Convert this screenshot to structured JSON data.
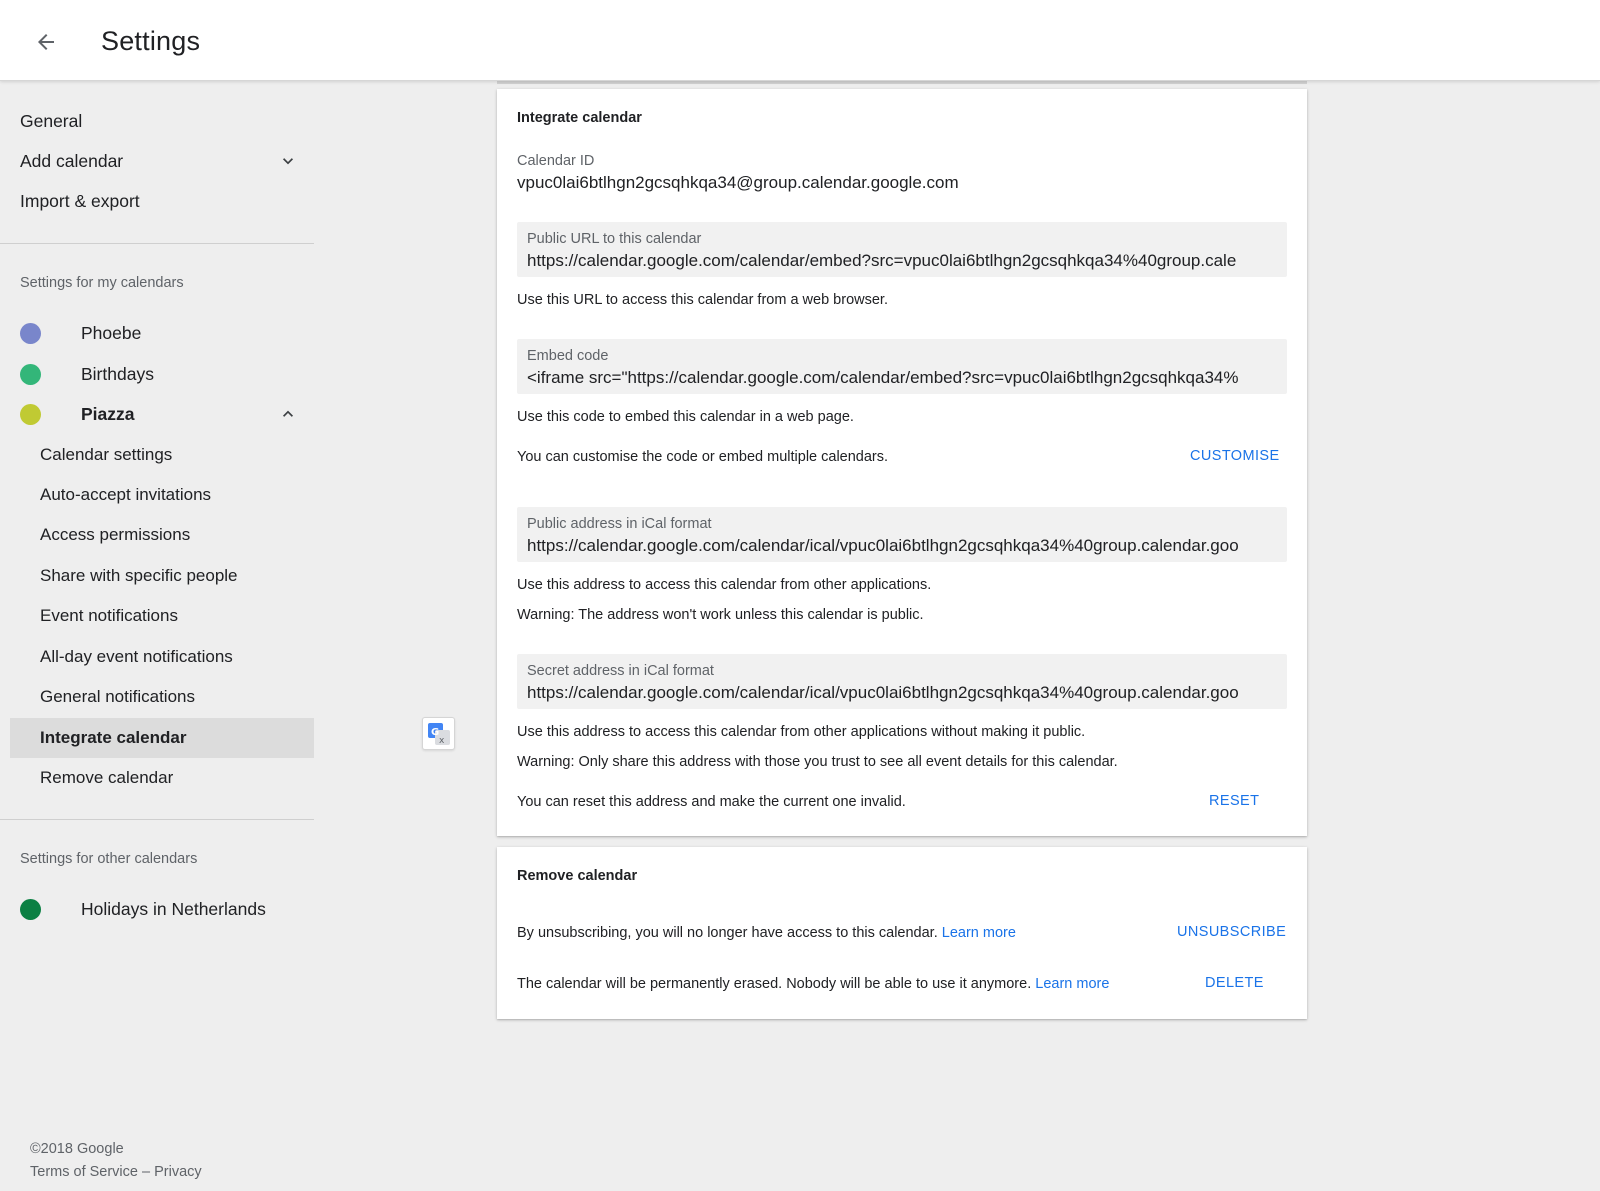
{
  "header": {
    "title": "Settings"
  },
  "sidebar": {
    "top_items": [
      {
        "label": "General"
      },
      {
        "label": "Add calendar"
      },
      {
        "label": "Import & export"
      }
    ],
    "my_calendars_label": "Settings for my calendars",
    "my_calendars": [
      {
        "name": "Phoebe",
        "color": "#7986cb"
      },
      {
        "name": "Birthdays",
        "color": "#33b679"
      },
      {
        "name": "Piazza",
        "color": "#c0ca33"
      }
    ],
    "piazza_subitems": [
      {
        "label": "Calendar settings"
      },
      {
        "label": "Auto-accept invitations"
      },
      {
        "label": "Access permissions"
      },
      {
        "label": "Share with specific people"
      },
      {
        "label": "Event notifications"
      },
      {
        "label": "All-day event notifications"
      },
      {
        "label": "General notifications"
      },
      {
        "label": "Integrate calendar"
      },
      {
        "label": "Remove calendar"
      }
    ],
    "active_subitem": "Integrate calendar",
    "other_calendars_label": "Settings for other calendars",
    "other_calendars": [
      {
        "name": "Holidays in Netherlands",
        "color": "#0b8043"
      }
    ]
  },
  "footer": {
    "copyright": "©2018 Google",
    "terms": "Terms of Service",
    "separator": "–",
    "privacy": "Privacy"
  },
  "integrate": {
    "title": "Integrate calendar",
    "calendar_id_label": "Calendar ID",
    "calendar_id_value": "vpuc0lai6btlhgn2gcsqhkqa34@group.calendar.google.com",
    "public_url_label": "Public URL to this calendar",
    "public_url_value": "https://calendar.google.com/calendar/embed?src=vpuc0lai6btlhgn2gcsqhkqa34%40group.cale",
    "public_url_desc": "Use this URL to access this calendar from a web browser.",
    "embed_label": "Embed code",
    "embed_value": "<iframe src=\"https://calendar.google.com/calendar/embed?src=vpuc0lai6btlhgn2gcsqhkqa34%",
    "embed_desc": "Use this code to embed this calendar in a web page.",
    "customise_desc": "You can customise the code or embed multiple calendars.",
    "customise_button": "CUSTOMISE",
    "ical_public_label": "Public address in iCal format",
    "ical_public_value": "https://calendar.google.com/calendar/ical/vpuc0lai6btlhgn2gcsqhkqa34%40group.calendar.goo",
    "ical_public_desc": "Use this address to access this calendar from other applications.",
    "ical_public_warning": "Warning: The address won't work unless this calendar is public.",
    "ical_secret_label": "Secret address in iCal format",
    "ical_secret_value": "https://calendar.google.com/calendar/ical/vpuc0lai6btlhgn2gcsqhkqa34%40group.calendar.goo",
    "ical_secret_desc": "Use this address to access this calendar from other applications without making it public.",
    "ical_secret_warning": "Warning: Only share this address with those you trust to see all event details for this calendar.",
    "reset_desc": "You can reset this address and make the current one invalid.",
    "reset_button": "RESET"
  },
  "remove": {
    "title": "Remove calendar",
    "unsubscribe_desc": "By unsubscribing, you will no longer have access to this calendar.",
    "unsubscribe_link": "Learn more",
    "unsubscribe_button": "UNSUBSCRIBE",
    "delete_desc": "The calendar will be permanently erased. Nobody will be able to use it anymore.",
    "delete_link": "Learn more",
    "delete_button": "DELETE"
  },
  "colors": {
    "accent": "#1a73e8",
    "active_bg": "#dcdcdc",
    "page_bg": "#eeeeee"
  },
  "icons": {
    "back": "arrow-left-icon",
    "expand": "chevron-down-icon",
    "collapse": "chevron-up-icon",
    "translate": "google-translate-icon"
  }
}
